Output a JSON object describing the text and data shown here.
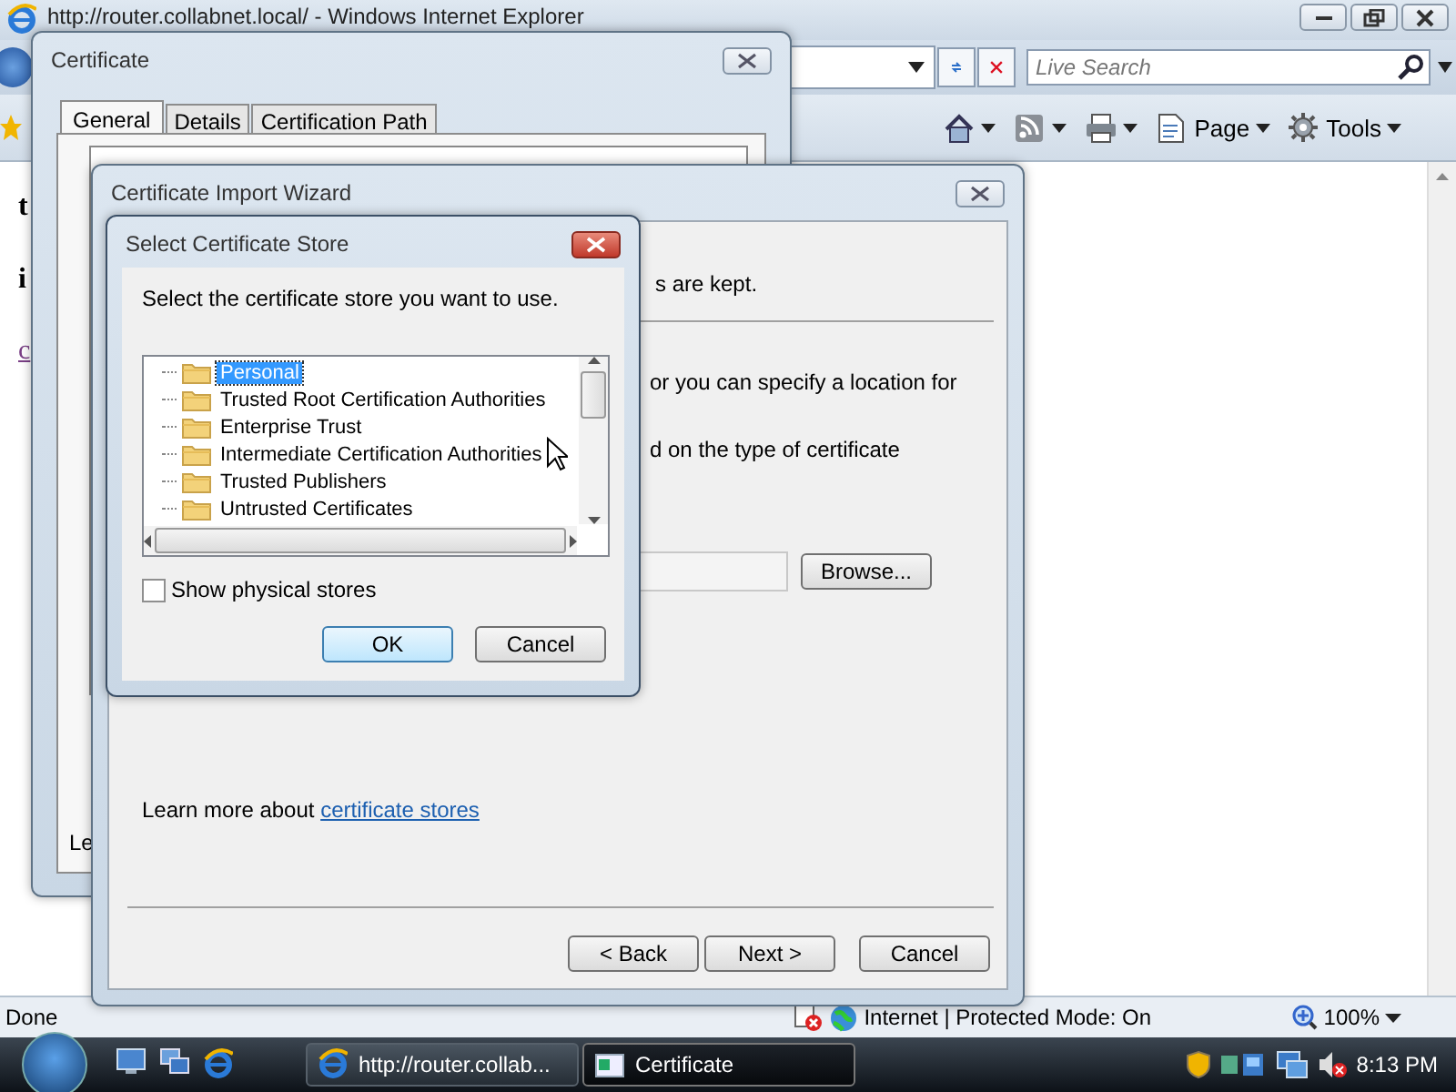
{
  "browser": {
    "title": "http://router.collabnet.local/ - Windows Internet Explorer",
    "search": {
      "placeholder": "Live Search"
    },
    "commands": [
      {
        "kind": "home"
      },
      {
        "kind": "feeds"
      },
      {
        "kind": "print"
      },
      {
        "kind": "page",
        "label": "Page"
      },
      {
        "kind": "tools",
        "label": "Tools"
      }
    ],
    "page_fragments": [
      {
        "kind": "bold",
        "text": "t"
      },
      {
        "kind": "bold",
        "text": "i"
      },
      {
        "kind": "link",
        "text": "c"
      }
    ],
    "status_bar": {
      "status": "Done",
      "zone": "Internet | Protected Mode: On",
      "zoom": "100%"
    }
  },
  "certificate_window": {
    "title": "Certificate",
    "tabs": [
      {
        "label": "General",
        "selected": true
      },
      {
        "label": "Details",
        "selected": false
      },
      {
        "label": "Certification Path",
        "selected": false
      }
    ],
    "fragment": "Le"
  },
  "wizard": {
    "title": "Certificate Import Wizard",
    "fragments": [
      "s are kept.",
      "or you can specify a location for",
      "d on the type of certificate"
    ],
    "browse_button": "Browse...",
    "learn_more": "Learn more about",
    "link": "certificate stores",
    "buttons": [
      "< Back",
      "Next >",
      "Cancel"
    ]
  },
  "store_dialog": {
    "title": "Select Certificate Store",
    "instruction": "Select the certificate store you want to use.",
    "stores": [
      {
        "label": "Personal",
        "selected": true
      },
      {
        "label": "Trusted Root Certification Authorities",
        "selected": false
      },
      {
        "label": "Enterprise Trust",
        "selected": false
      },
      {
        "label": "Intermediate Certification Authorities",
        "selected": false
      },
      {
        "label": "Trusted Publishers",
        "selected": false
      },
      {
        "label": "Untrusted Certificates",
        "selected": false
      }
    ],
    "show_physical_stores": {
      "label": "Show physical stores",
      "checked": false
    },
    "buttons": [
      {
        "label": "OK",
        "default": true
      },
      {
        "label": "Cancel",
        "default": false
      }
    ]
  },
  "taskbar": {
    "tasks": [
      {
        "label": "http://router.collab...",
        "kind": "browser",
        "selected": false
      },
      {
        "label": "Certificate",
        "kind": "certificate",
        "selected": true
      }
    ],
    "clock": "8:13 PM"
  }
}
